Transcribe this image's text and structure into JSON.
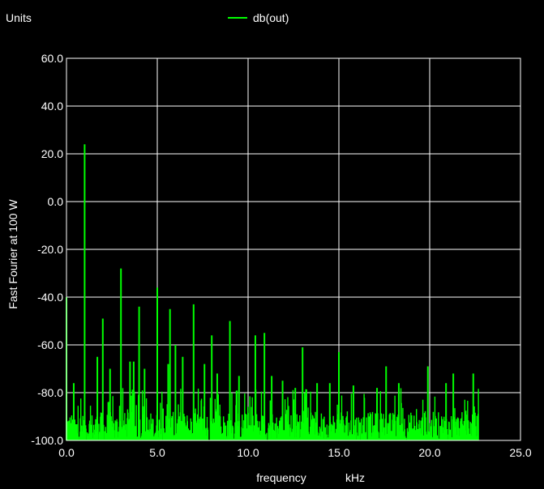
{
  "header": {
    "units_label": "Units"
  },
  "chart_data": {
    "type": "line",
    "title": "",
    "xlabel": "frequency",
    "xunit": "kHz",
    "ylabel": "Fast Fourier at 100 W",
    "xlim": [
      0.0,
      25.0
    ],
    "ylim": [
      -100.0,
      60.0
    ],
    "xticks": [
      0.0,
      5.0,
      10.0,
      15.0,
      20.0,
      25.0
    ],
    "yticks": [
      60.0,
      40.0,
      20.0,
      0.0,
      -20.0,
      -40.0,
      -60.0,
      -80.0,
      -100.0
    ],
    "xtick_labels": [
      "0.0",
      "5.0",
      "10.0",
      "15.0",
      "20.0",
      "25.0"
    ],
    "ytick_labels": [
      "60.0",
      "40.0",
      "20.0",
      "0.0",
      "-20.0",
      "-40.0",
      "-60.0",
      "-80.0",
      "-100.0"
    ],
    "grid": true,
    "legend_position": "top-center",
    "series": [
      {
        "name": "db(out)",
        "color": "#00ff00",
        "x_max": 22.7,
        "peaks": [
          {
            "x": 0.0,
            "y": -40
          },
          {
            "x": 0.4,
            "y": -76
          },
          {
            "x": 1.0,
            "y": 24
          },
          {
            "x": 1.7,
            "y": -65
          },
          {
            "x": 2.0,
            "y": -49
          },
          {
            "x": 2.4,
            "y": -70
          },
          {
            "x": 3.0,
            "y": -28
          },
          {
            "x": 3.5,
            "y": -67
          },
          {
            "x": 3.7,
            "y": -67
          },
          {
            "x": 4.0,
            "y": -44
          },
          {
            "x": 4.3,
            "y": -70
          },
          {
            "x": 5.0,
            "y": -36
          },
          {
            "x": 5.6,
            "y": -68
          },
          {
            "x": 5.7,
            "y": -45
          },
          {
            "x": 6.0,
            "y": -60
          },
          {
            "x": 6.4,
            "y": -65
          },
          {
            "x": 7.0,
            "y": -43
          },
          {
            "x": 7.6,
            "y": -68
          },
          {
            "x": 8.0,
            "y": -56
          },
          {
            "x": 8.3,
            "y": -72
          },
          {
            "x": 9.0,
            "y": -50
          },
          {
            "x": 9.5,
            "y": -73
          },
          {
            "x": 10.4,
            "y": -56
          },
          {
            "x": 10.9,
            "y": -55
          },
          {
            "x": 11.3,
            "y": -73
          },
          {
            "x": 11.9,
            "y": -75
          },
          {
            "x": 12.6,
            "y": -78
          },
          {
            "x": 13.0,
            "y": -61
          },
          {
            "x": 13.8,
            "y": -76
          },
          {
            "x": 14.5,
            "y": -76
          },
          {
            "x": 15.0,
            "y": -63
          },
          {
            "x": 15.8,
            "y": -77
          },
          {
            "x": 17.1,
            "y": -78
          },
          {
            "x": 17.6,
            "y": -69
          },
          {
            "x": 18.3,
            "y": -76
          },
          {
            "x": 19.9,
            "y": -69
          },
          {
            "x": 20.9,
            "y": -76
          },
          {
            "x": 21.3,
            "y": -72
          },
          {
            "x": 22.4,
            "y": -72
          }
        ],
        "noise_floor": [
          -100,
          -88
        ]
      }
    ]
  }
}
